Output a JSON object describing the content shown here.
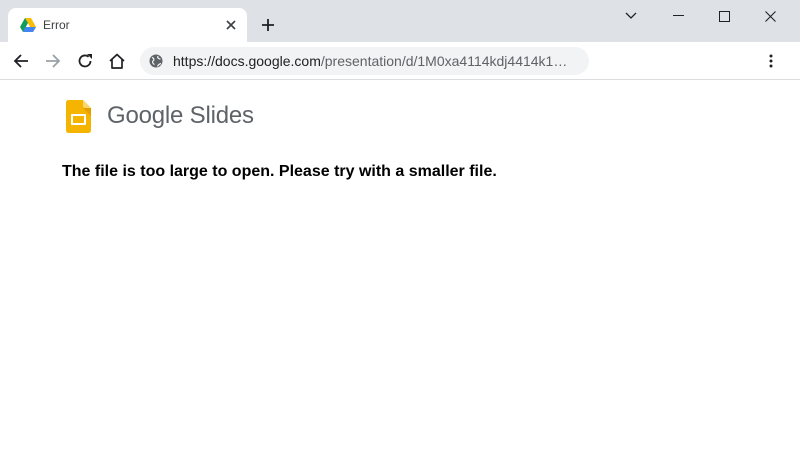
{
  "browser": {
    "tab": {
      "title": "Error",
      "favicon": "google-drive-icon"
    },
    "new_tab_icon": "plus-icon",
    "window_controls": [
      "chevron-down-icon",
      "minimize-icon",
      "maximize-icon",
      "close-icon"
    ],
    "address": {
      "host": "https://docs.google.com",
      "path": "/presentation/d/1M0xa4114kdj4414k1…",
      "site_icon": "globe-icon"
    }
  },
  "page": {
    "brand": "Google Slides",
    "message": "The file is too large to open. Please try with a smaller file."
  },
  "colors": {
    "slides_yellow": "#f4b400",
    "tabstrip": "#dee1e6",
    "omnibox": "#f1f3f4"
  }
}
